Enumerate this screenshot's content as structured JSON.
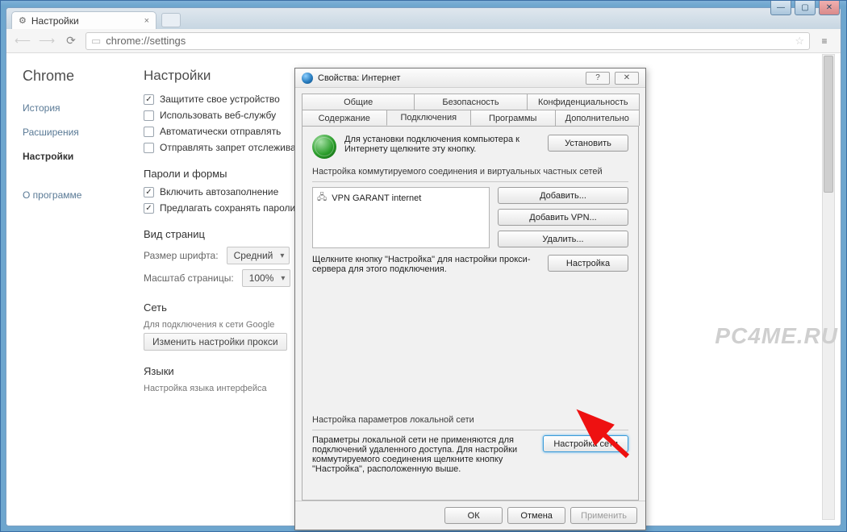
{
  "browser": {
    "tab_title": "Настройки",
    "url_display": "chrome://settings",
    "nav_brand": "Chrome",
    "side_history": "История",
    "side_extensions": "Расширения",
    "side_settings": "Настройки",
    "side_about": "О программе"
  },
  "settings": {
    "title": "Настройки",
    "privacy_chk1": "Защитите свое устройство",
    "privacy_chk2": "Использовать веб-службу",
    "privacy_chk3": "Автоматически отправлять",
    "privacy_chk4": "Отправлять запрет отслеживания",
    "section_forms": "Пароли и формы",
    "forms_chk1": "Включить автозаполнение",
    "forms_chk2": "Предлагать сохранять пароли",
    "section_view": "Вид страниц",
    "font_label": "Размер шрифта:",
    "font_value": "Средний",
    "zoom_label": "Масштаб страницы:",
    "zoom_value": "100%",
    "section_net": "Сеть",
    "net_desc": "Для подключения к сети Google",
    "proxy_btn": "Изменить настройки прокси",
    "section_lang": "Языки",
    "lang_desc": "Настройка языка интерфейса"
  },
  "dialog": {
    "title": "Свойства: Интернет",
    "tabs_row1": [
      "Общие",
      "Безопасность",
      "Конфиденциальность"
    ],
    "tabs_row2": [
      "Содержание",
      "Подключения",
      "Программы",
      "Дополнительно"
    ],
    "install_text": "Для установки подключения компьютера к Интернету щелкните эту кнопку.",
    "install_btn": "Установить",
    "dial_label": "Настройка коммутируемого соединения и виртуальных частных сетей",
    "vpn_item": "VPN GARANT internet",
    "add_btn": "Добавить...",
    "add_vpn_btn": "Добавить VPN...",
    "remove_btn": "Удалить...",
    "configure_btn": "Настройка",
    "proxy_note": "Щелкните кнопку \"Настройка\" для настройки прокси-сервера для этого подключения.",
    "lan_label": "Настройка параметров локальной сети",
    "lan_note": "Параметры локальной сети не применяются для подключений удаленного доступа. Для настройки коммутируемого соединения щелкните кнопку \"Настройка\", расположенную выше.",
    "lan_btn": "Настройка сети",
    "ok": "ОК",
    "cancel": "Отмена",
    "apply": "Применить"
  },
  "watermark": "PC4ME.RU"
}
